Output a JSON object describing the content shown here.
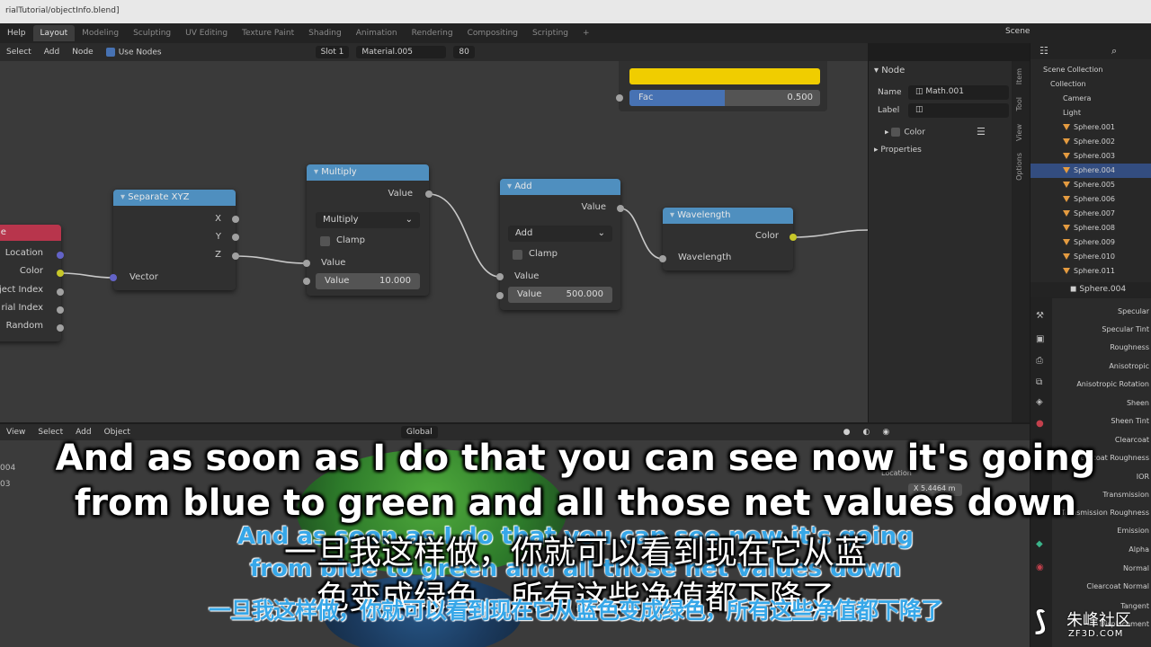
{
  "window": {
    "title": "rialTutorial/objectInfo.blend]"
  },
  "menubar": {
    "help": "Help"
  },
  "workspace_tabs": [
    "Layout",
    "Modeling",
    "Sculpting",
    "UV Editing",
    "Texture Paint",
    "Shading",
    "Animation",
    "Rendering",
    "Compositing",
    "Scripting",
    "+"
  ],
  "scene": {
    "name": "Scene"
  },
  "node_header": {
    "select": "Select",
    "add": "Add",
    "node": "Node",
    "use_nodes": "Use Nodes",
    "slot": "Slot 1",
    "material": "Material.005",
    "users": "80"
  },
  "nodes": {
    "object_info": {
      "title": "le",
      "location": "Location",
      "color": "Color",
      "object_index": "ject Index",
      "material_index": "rial Index",
      "random": "Random"
    },
    "separate_xyz": {
      "title": "Separate XYZ",
      "x": "X",
      "y": "Y",
      "z": "Z",
      "vector": "Vector"
    },
    "multiply": {
      "title": "Multiply",
      "out_value": "Value",
      "op": "Multiply",
      "clamp": "Clamp",
      "in_value": "Value",
      "field_label": "Value",
      "field_value": "10.000"
    },
    "add": {
      "title": "Add",
      "out_value": "Value",
      "op": "Add",
      "clamp": "Clamp",
      "in_value": "Value",
      "field_label": "Value",
      "field_value": "500.000"
    },
    "wavelength": {
      "title": "Wavelength",
      "color": "Color",
      "wavelength": "Wavelength"
    },
    "color_node": {
      "fac_label": "Fac",
      "fac_value": "0.500",
      "fac_fraction": 0.5
    }
  },
  "sidebar": {
    "section": "Node",
    "name_label": "Name",
    "name_value": "Math.001",
    "label_label": "Label",
    "color_label": "Color",
    "properties_label": "Properties",
    "tabs": [
      "Item",
      "Tool",
      "View",
      "Options"
    ]
  },
  "outliner": {
    "rows": [
      "Scene Collection",
      "Collection",
      "Camera",
      "Light",
      "Sphere.001",
      "Sphere.002",
      "Sphere.003",
      "Sphere.004",
      "Sphere.005",
      "Sphere.006",
      "Sphere.007",
      "Sphere.008",
      "Sphere.009",
      "Sphere.010",
      "Sphere.011"
    ],
    "selected_index": 7
  },
  "properties": {
    "object": "Sphere.004",
    "labels": [
      "Specular",
      "Specular Tint",
      "Roughness",
      "Anisotropic",
      "Anisotropic Rotation",
      "Sheen",
      "Sheen Tint",
      "Clearcoat",
      "Clearcoat Roughness",
      "IOR",
      "Transmission",
      "Transmission Roughness",
      "Emission",
      "Alpha",
      "Normal",
      "Clearcoat Normal",
      "Tangent",
      "Displacement"
    ]
  },
  "viewport_header": {
    "view": "View",
    "select": "Select",
    "add": "Add",
    "object": "Object",
    "transform": "Global"
  },
  "viewport": {
    "left_a": "004",
    "left_b": "03",
    "location": "Location",
    "x_label": "X",
    "x_value": "5.4464 m"
  },
  "subtitles": {
    "en_line1": "And as soon as I do that you can see now it's going",
    "en_line2": "from blue to green and all those net values down",
    "zh_line1": "一旦我这样做，你就可以看到现在它从蓝",
    "zh_line2": "色变成绿色，所有这些净值都下降了",
    "ghost_en1": "And as soon as I do that you can see now it's going",
    "ghost_en2": "from blue to green and all those net values down",
    "ghost_zh": "一旦我这样做，你就可以看到现在它从蓝色变成绿色，所有这些净值都下降了"
  },
  "watermark": {
    "name": "朱峰社区",
    "url": "ZF3D.COM"
  },
  "colors": {
    "node_header": "#4f8fbf",
    "object_info_header": "#b8354c",
    "yellow": "#f0cd00",
    "accent": "#4772b3"
  }
}
